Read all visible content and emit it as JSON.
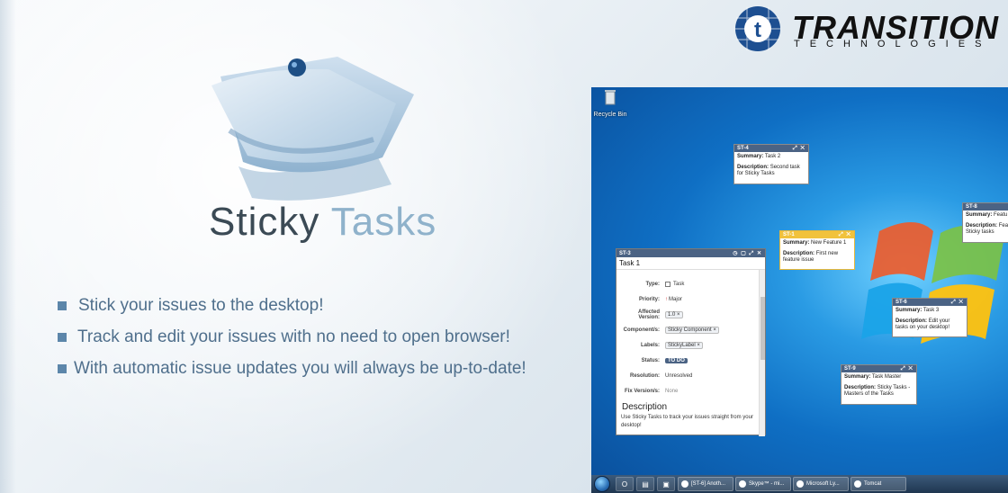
{
  "brand": {
    "name": "TRANSITION",
    "sub": "TECHNOLOGIES",
    "mark_letter": "t"
  },
  "product": {
    "word1": "Sticky",
    "word2": "Tasks"
  },
  "features": [
    "Stick your issues to the desktop!",
    "Track and edit your issues with no need to open browser!",
    "With automatic issue updates you will always be up-to-date!"
  ],
  "desktop": {
    "recycle_label": "Recycle Bin",
    "stickies": [
      {
        "key": "ST-4",
        "summary_label": "Summary:",
        "summary": "Task 2",
        "desc_label": "Description:",
        "desc": "Second task for Sticky Tasks",
        "color": "blue"
      },
      {
        "key": "ST-8",
        "summary_label": "Summary:",
        "summary": "Featu",
        "desc_label": "Description:",
        "desc": "Feat Sticky tasks",
        "color": "blue"
      },
      {
        "key": "ST-1",
        "summary_label": "Summary:",
        "summary": "New Feature 1",
        "desc_label": "Description:",
        "desc": "First new feature issue",
        "color": "yellow"
      },
      {
        "key": "ST-6",
        "summary_label": "Summary:",
        "summary": "Task 3",
        "desc_label": "Description:",
        "desc": "Edit your tasks on your desktop!",
        "color": "blue"
      },
      {
        "key": "ST-9",
        "summary_label": "Summary:",
        "summary": "Task Master",
        "desc_label": "Description:",
        "desc": "Sticky Tasks - Masters of the Tasks",
        "color": "blue"
      }
    ],
    "detail": {
      "key": "ST-3",
      "title": "Task 1",
      "fields": {
        "type_label": "Type:",
        "type": "Task",
        "priority_label": "Priority:",
        "priority": "Major",
        "affected_label": "Affected Version:",
        "affected": "1.0 ×",
        "components_label": "Component/s:",
        "components": "Sticky Component ×",
        "labels_label": "Labels:",
        "labels": "StickyLabel ×",
        "status_label": "Status:",
        "status": "TO DO",
        "resolution_label": "Resolution:",
        "resolution": "Unresolved",
        "fix_label": "Fix Version/s:",
        "fix": "None"
      },
      "desc_heading": "Description",
      "desc_text": "Use Sticky Tasks to track your issues straight from your desktop!"
    },
    "taskbar": {
      "tasks": [
        "[ST-6] Anoth...",
        "Skype™ - mi...",
        "Microsoft Ly...",
        "Tomcat"
      ]
    }
  },
  "colors": {
    "accent": "#4b6384",
    "feature_text": "#4f6f8c",
    "sticky_yellow": "#f1c23c"
  }
}
